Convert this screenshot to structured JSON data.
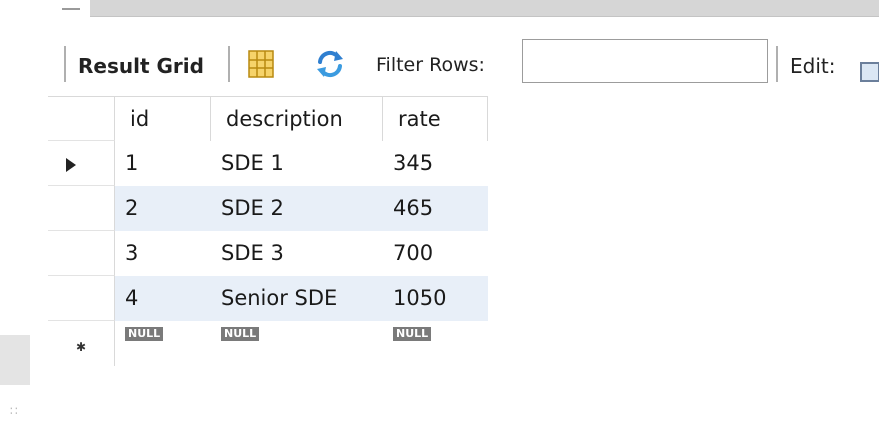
{
  "toolbar": {
    "result_grid_label": "Result Grid",
    "filter_rows_label": "Filter Rows:",
    "filter_value": "",
    "edit_label": "Edit:"
  },
  "grid": {
    "columns": [
      "id",
      "description",
      "rate"
    ],
    "rows": [
      {
        "id": "1",
        "description": "SDE 1",
        "rate": "345"
      },
      {
        "id": "2",
        "description": "SDE 2",
        "rate": "465"
      },
      {
        "id": "3",
        "description": "SDE 3",
        "rate": "700"
      },
      {
        "id": "4",
        "description": "Senior SDE",
        "rate": "1050"
      }
    ],
    "new_row": {
      "id": "NULL",
      "description": "NULL",
      "rate": "NULL"
    },
    "selected_row_index": 0
  },
  "colors": {
    "alt_row": "#e8eff8",
    "null_badge": "#7a7a7a",
    "refresh_icon": "#2f7fd0",
    "grid_icon": "#e8b21f"
  },
  "icons": {
    "grid_layout": "grid-layout-icon",
    "refresh": "refresh-icon",
    "edit": "edit-icon"
  }
}
